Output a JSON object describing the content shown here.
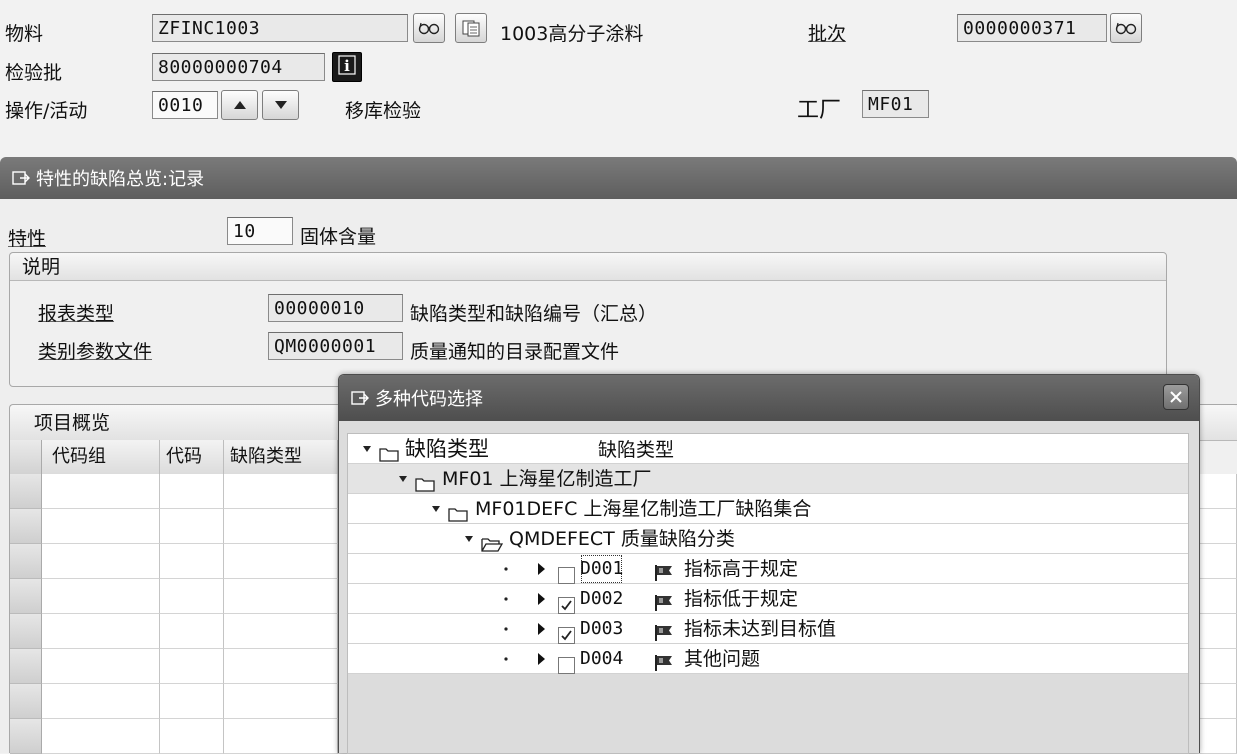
{
  "header": {
    "material_label": "物料",
    "material_value": "ZFINC1003",
    "material_desc": "1003高分子涂料",
    "batch_label": "批次",
    "batch_value": "0000000371",
    "inspection_lot_label": "检验批",
    "inspection_lot_value": "80000000704",
    "operation_label": "操作/活动",
    "operation_value": "0010",
    "operation_desc": "移库检验",
    "plant_label": "工厂",
    "plant_value": "MF01"
  },
  "defects_panel": {
    "title": "特性的缺陷总览:记录",
    "characteristic_label": "特性",
    "characteristic_value": "10",
    "characteristic_desc": "固体含量",
    "explanation_group": {
      "title": "说明",
      "report_type_label": "报表类型",
      "report_type_value": "00000010",
      "report_type_desc": "缺陷类型和缺陷编号（汇总）",
      "catalog_profile_label": "类别参数文件",
      "catalog_profile_value": "QM0000001",
      "catalog_profile_desc": "质量通知的目录配置文件"
    },
    "items_overview": {
      "title": "项目概览",
      "columns": [
        "代码组",
        "代码",
        "缺陷类型"
      ]
    }
  },
  "dialog": {
    "title": "多种代码选择",
    "tree": {
      "root_label": "缺陷类型",
      "root_desc": "缺陷类型",
      "plant_node": "MF01 上海星亿制造工厂",
      "set_node": "MF01DEFC 上海星亿制造工厂缺陷集合",
      "group_node": "QMDEFECT 质量缺陷分类",
      "codes": [
        {
          "code": "D001",
          "text": "指标高于规定",
          "checked": false
        },
        {
          "code": "D002",
          "text": "指标低于规定",
          "checked": true
        },
        {
          "code": "D003",
          "text": "指标未达到目标值",
          "checked": true
        },
        {
          "code": "D004",
          "text": "其他问题",
          "checked": false
        }
      ]
    }
  },
  "icons": {
    "match": "glasses-icon",
    "copy": "document-icon",
    "info": "info-icon",
    "up": "triangle-up-icon",
    "down": "triangle-down-icon",
    "folder": "folder-icon",
    "folder_open": "folder-open-icon",
    "flag": "flag-icon",
    "close": "close-icon",
    "panel_toggle": "panel-toggle-icon"
  }
}
